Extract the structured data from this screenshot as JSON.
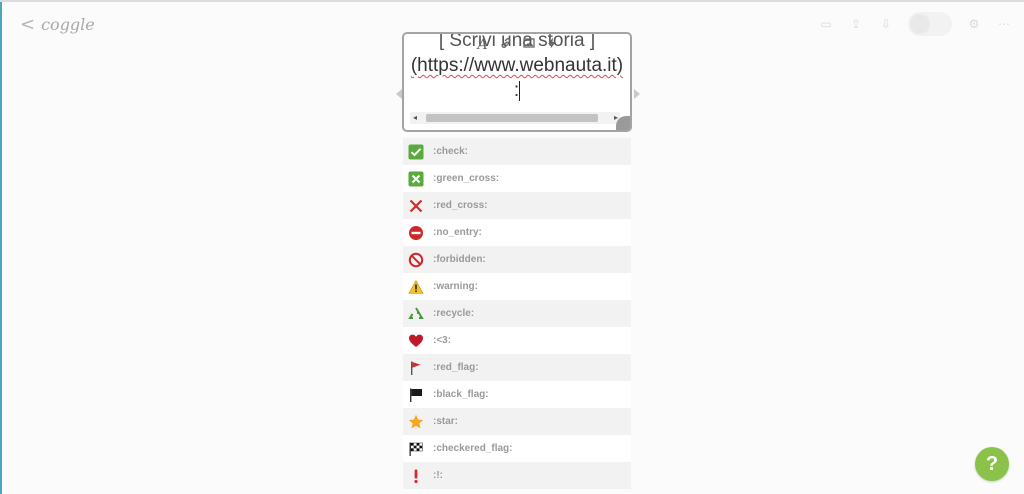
{
  "app": {
    "logo": "coggle",
    "back_glyph": "<"
  },
  "editor": {
    "toolbar": {
      "format_glyph": "A",
      "link_glyph": "🔗",
      "image_glyph": "▣",
      "action_glyph": "⚡"
    },
    "line1": "[ Scrivi una storia ]",
    "line2": "(https://www.webnauta.it)",
    "line3": ":"
  },
  "emoji_list": [
    {
      "icon": "check-mark-icon",
      "label": ":check:"
    },
    {
      "icon": "green-cross-icon",
      "label": ":green_cross:"
    },
    {
      "icon": "red-cross-icon",
      "label": ":red_cross:"
    },
    {
      "icon": "no-entry-icon",
      "label": ":no_entry:"
    },
    {
      "icon": "forbidden-icon",
      "label": ":forbidden:"
    },
    {
      "icon": "warning-icon",
      "label": ":warning:"
    },
    {
      "icon": "recycle-icon",
      "label": ":recycle:"
    },
    {
      "icon": "heart-icon",
      "label": ":<3:"
    },
    {
      "icon": "red-flag-icon",
      "label": ":red_flag:"
    },
    {
      "icon": "black-flag-icon",
      "label": ":black_flag:"
    },
    {
      "icon": "star-icon",
      "label": ":star:"
    },
    {
      "icon": "checkered-flag-icon",
      "label": ":checkered_flag:"
    },
    {
      "icon": "exclamation-icon",
      "label": ":!:"
    }
  ],
  "help": {
    "label": "?"
  },
  "colors": {
    "help_green": "#8bc34a",
    "check_green": "#5aab3e",
    "cross_red": "#d62b2b",
    "star_orange": "#f5a623"
  }
}
